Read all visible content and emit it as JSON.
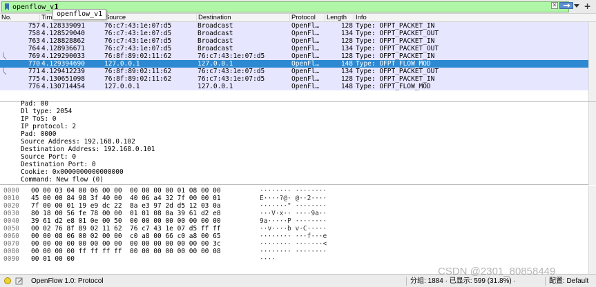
{
  "filter": {
    "value": "openflow_v1",
    "suggestion": "openflow_v1"
  },
  "columns": [
    "No.",
    "Time",
    "Source",
    "Destination",
    "Protocol",
    "Length",
    "Info"
  ],
  "packets": [
    {
      "no": "757",
      "time": "4.128339091",
      "src": "76:c7:43:1e:07:d5",
      "dst": "Broadcast",
      "proto": "OpenFl…",
      "len": "128",
      "info": "Type: OFPT_PACKET_IN"
    },
    {
      "no": "758",
      "time": "4.128529040",
      "src": "76:c7:43:1e:07:d5",
      "dst": "Broadcast",
      "proto": "OpenFl…",
      "len": "134",
      "info": "Type: OFPT_PACKET_OUT"
    },
    {
      "no": "763",
      "time": "4.128828862",
      "src": "76:c7:43:1e:07:d5",
      "dst": "Broadcast",
      "proto": "OpenFl…",
      "len": "128",
      "info": "Type: OFPT_PACKET_IN"
    },
    {
      "no": "764",
      "time": "4.128936671",
      "src": "76:c7:43:1e:07:d5",
      "dst": "Broadcast",
      "proto": "OpenFl…",
      "len": "134",
      "info": "Type: OFPT_PACKET_OUT"
    },
    {
      "no": "769",
      "time": "4.129290033",
      "src": "76:8f:89:02:11:62",
      "dst": "76:c7:43:1e:07:d5",
      "proto": "OpenFl…",
      "len": "128",
      "info": "Type: OFPT_PACKET_IN"
    },
    {
      "no": "770",
      "time": "4.129394690",
      "src": "127.0.0.1",
      "dst": "127.0.0.1",
      "proto": "OpenFl…",
      "len": "148",
      "info": "Type: OFPT_FLOW_MOD"
    },
    {
      "no": "771",
      "time": "4.129412239",
      "src": "76:8f:89:02:11:62",
      "dst": "76:c7:43:1e:07:d5",
      "proto": "OpenFl…",
      "len": "134",
      "info": "Type: OFPT_PACKET_OUT"
    },
    {
      "no": "775",
      "time": "4.130651098",
      "src": "76:8f:89:02:11:62",
      "dst": "76:c7:43:1e:07:d5",
      "proto": "OpenFl…",
      "len": "128",
      "info": "Type: OFPT_PACKET_IN"
    },
    {
      "no": "776",
      "time": "4.130714454",
      "src": "127.0.0.1",
      "dst": "127.0.0.1",
      "proto": "OpenFl…",
      "len": "148",
      "info": "Type: OFPT_FLOW_MOD"
    }
  ],
  "details": [
    "Pad: 00",
    "Dl type: 2054",
    "IP ToS: 0",
    "IP protocol: 2",
    "Pad: 0000",
    "Source Address: 192.168.0.102",
    "Destination Address: 192.168.0.101",
    "Source Port: 0",
    "Destination Port: 0",
    "Cookie: 0x0000000000000000",
    "Command: New flow (0)"
  ],
  "hex": [
    {
      "offset": "0000",
      "bytes": "00 00 03 04 00 06 00 00  00 00 00 00 01 08 00 00",
      "ascii": "········ ········"
    },
    {
      "offset": "0010",
      "bytes": "45 00 00 84 98 3f 40 00  40 06 a4 32 7f 00 00 01",
      "ascii": "E····?@· @··2····"
    },
    {
      "offset": "0020",
      "bytes": "7f 00 00 01 19 e9 dc 22  8a e3 97 2d d5 12 03 0a",
      "ascii": "·······\" ···-····"
    },
    {
      "offset": "0030",
      "bytes": "80 18 00 56 fe 78 00 00  01 01 08 0a 39 61 d2 e8",
      "ascii": "···V·x·· ····9a··"
    },
    {
      "offset": "0040",
      "bytes": "39 61 d2 e8 01 0e 00 50  00 00 00 00 00 00 00 00",
      "ascii": "9a·····P ········"
    },
    {
      "offset": "0050",
      "bytes": "00 02 76 8f 89 02 11 62  76 c7 43 1e 07 d5 ff ff",
      "ascii": "··v····b v·C·····"
    },
    {
      "offset": "0060",
      "bytes": "00 00 08 06 00 02 00 00  c0 a8 00 66 c0 a8 00 65",
      "ascii": "········ ···f···e"
    },
    {
      "offset": "0070",
      "bytes": "00 00 00 00 00 00 00 00  00 00 00 00 00 00 00 3c",
      "ascii": "········ ·······<"
    },
    {
      "offset": "0080",
      "bytes": "00 00 00 00 ff ff ff ff  00 00 00 00 00 00 00 08",
      "ascii": "········ ········"
    },
    {
      "offset": "0090",
      "bytes": "00 01 00 00",
      "ascii": "····"
    }
  ],
  "status": {
    "protocol": "OpenFlow 1.0: Protocol",
    "stats": "分组: 1884 · 已显示: 599 (31.8%) ·",
    "profile": "配置: Default"
  },
  "watermark": "CSDN @2301_80858449",
  "colors": {
    "filter_ok": "#aff7a6",
    "selected_row": "#2d8ad2",
    "openflow_row": "#e7e6ff"
  },
  "icons": [
    "bookmark-icon",
    "clear-icon",
    "apply-arrow-icon",
    "dropdown-arrow-icon",
    "add-filter-icon",
    "status-led-icon",
    "edit-comment-icon"
  ]
}
